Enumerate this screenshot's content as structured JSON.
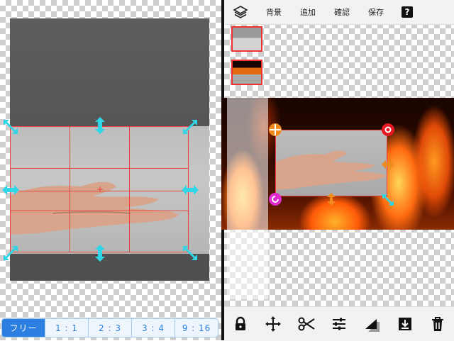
{
  "toolbar": {
    "background_label": "背景",
    "add_label": "追加",
    "confirm_label": "確認",
    "save_label": "保存",
    "help_label": "?"
  },
  "aspect_options": [
    "フリー",
    "1 : 1",
    "2 : 3",
    "3 : 4",
    "9 : 16"
  ],
  "selected_aspect": "フリー",
  "icons": {
    "top": [
      "layers-icon",
      "help-icon"
    ],
    "bottom": [
      "lock-icon",
      "move-icon",
      "scissors-icon",
      "sliders-icon",
      "shadow-icon",
      "download-box-icon",
      "trash-icon"
    ],
    "crop_handles": [
      "resize-arrow-icon"
    ],
    "layer_handles": [
      "crosshair-icon",
      "close-icon",
      "rotate-icon",
      "horizontal-resize-icon",
      "vertical-resize-icon",
      "diagonal-resize-icon"
    ]
  },
  "colors": {
    "accent": "#2a7fe0",
    "crop_line": "#e8423f",
    "handle_cyan": "#2fd6e6",
    "handle_orange": "#f08a1c",
    "handle_red": "#e5191f",
    "handle_magenta": "#e02ad0"
  }
}
